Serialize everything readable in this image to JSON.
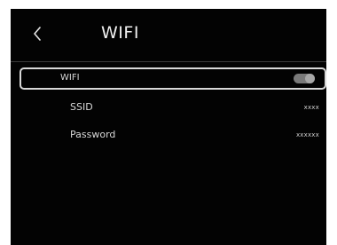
{
  "header": {
    "back_icon": "chevron-left-icon",
    "title": "WIFI"
  },
  "settings": {
    "wifi": {
      "label": "WIFI",
      "enabled": true
    },
    "ssid": {
      "label": "SSID",
      "value": "xxxx"
    },
    "password": {
      "label": "Password",
      "value": "xxxxxx"
    }
  },
  "colors": {
    "background": "#030303",
    "text": "#f0f0f0",
    "highlight_border": "#d8d8d8",
    "toggle_track": "#7a7a7a",
    "toggle_knob": "#a8a8a8"
  }
}
